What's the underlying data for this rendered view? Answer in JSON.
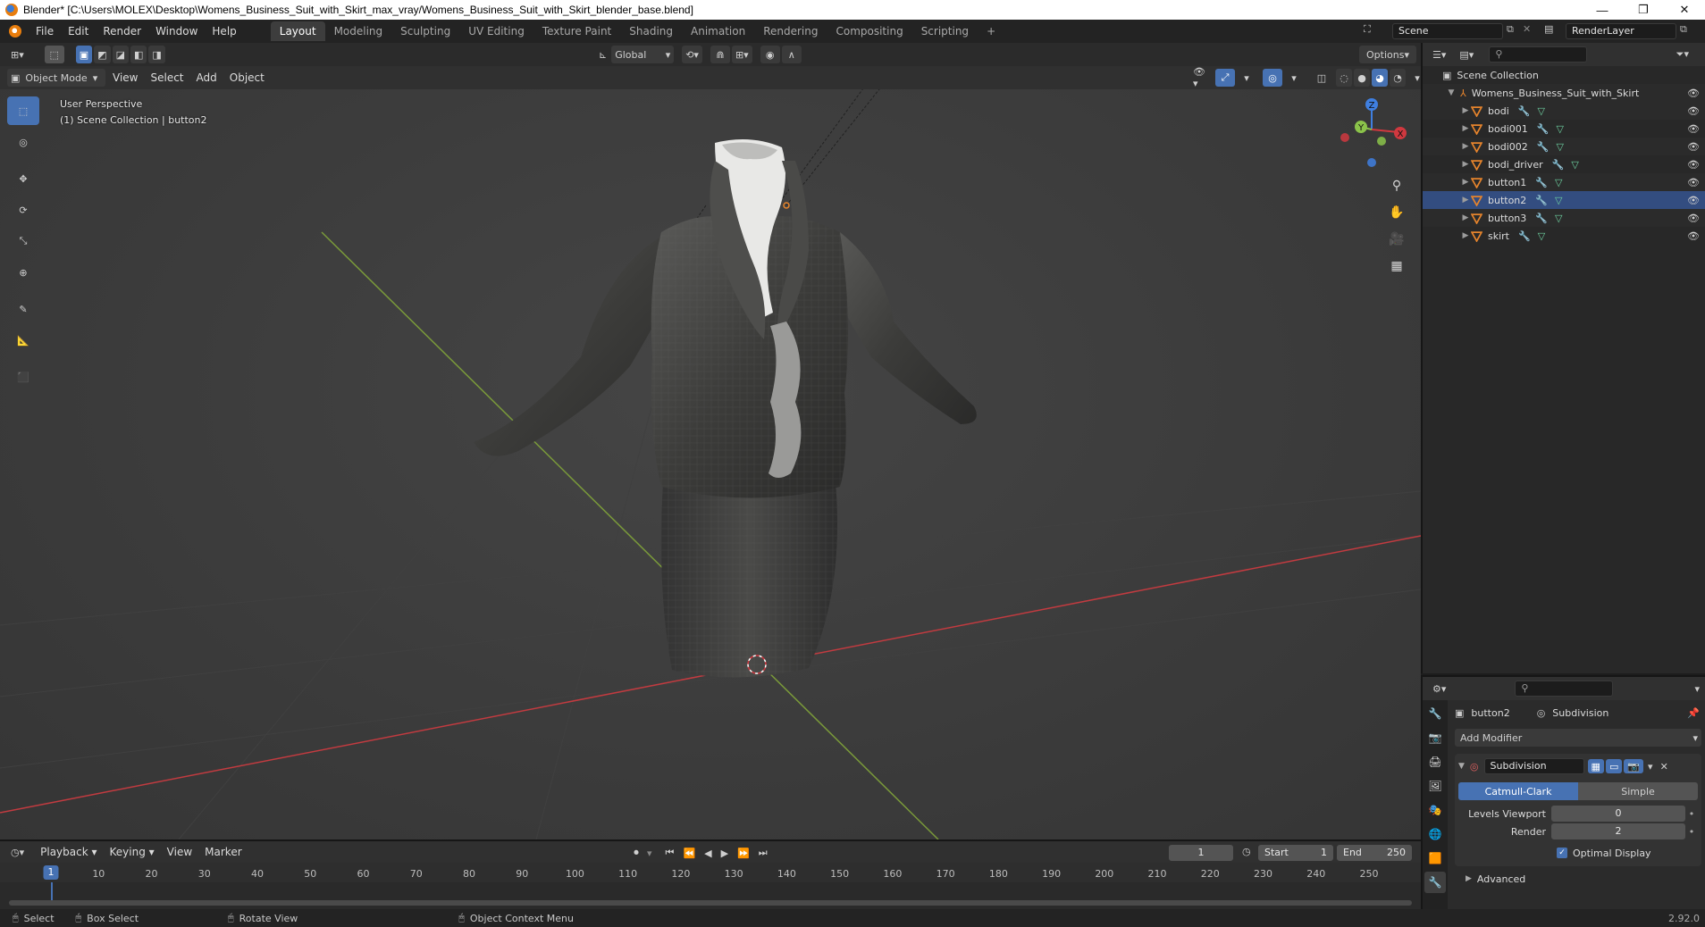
{
  "titlebar": {
    "title": "Blender* [C:\\Users\\MOLEX\\Desktop\\Womens_Business_Suit_with_Skirt_max_vray/Womens_Business_Suit_with_Skirt_blender_base.blend]",
    "minimize": "—",
    "restore": "❐",
    "close": "✕"
  },
  "menu": [
    "File",
    "Edit",
    "Render",
    "Window",
    "Help"
  ],
  "workspaces": [
    "Layout",
    "Modeling",
    "Sculpting",
    "UV Editing",
    "Texture Paint",
    "Shading",
    "Animation",
    "Rendering",
    "Compositing",
    "Scripting"
  ],
  "workspace_active": "Layout",
  "workspace_add": "+",
  "scene": {
    "name": "Scene",
    "render_layer": "RenderLayer"
  },
  "tool_header": {
    "orientation": "Global",
    "options": "Options"
  },
  "viewport_header": {
    "mode": "Object Mode",
    "menus": [
      "View",
      "Select",
      "Add",
      "Object"
    ]
  },
  "viewport": {
    "perspective_label": "User Perspective",
    "collection_label": "(1) Scene Collection | button2",
    "gizmo": {
      "x": "X",
      "y": "Y",
      "z": "Z"
    }
  },
  "outliner": {
    "root": "Scene Collection",
    "collection": "Womens_Business_Suit_with_Skirt",
    "objects": [
      "bodi",
      "bodi001",
      "bodi002",
      "bodi_driver",
      "button1",
      "button2",
      "button3",
      "skirt"
    ],
    "selected": "button2"
  },
  "properties": {
    "object": "button2",
    "modifier_tab": "Subdivision",
    "add_modifier": "Add Modifier",
    "modifier_name": "Subdivision",
    "mode_catmull": "Catmull-Clark",
    "mode_simple": "Simple",
    "levels_viewport_label": "Levels Viewport",
    "levels_viewport_value": "0",
    "render_label": "Render",
    "render_value": "2",
    "optimal_display": "Optimal Display",
    "advanced": "Advanced"
  },
  "timeline": {
    "menus": [
      "Playback",
      "Keying",
      "View",
      "Marker"
    ],
    "current_frame": "1",
    "start_label": "Start",
    "start_value": "1",
    "end_label": "End",
    "end_value": "250",
    "ticks": [
      "1",
      "10",
      "20",
      "30",
      "40",
      "50",
      "60",
      "70",
      "80",
      "90",
      "100",
      "110",
      "120",
      "130",
      "140",
      "150",
      "160",
      "170",
      "180",
      "190",
      "200",
      "210",
      "220",
      "230",
      "240",
      "250"
    ]
  },
  "statusbar": {
    "select": "Select",
    "box_select": "Box Select",
    "rotate_view": "Rotate View",
    "context_menu": "Object Context Menu",
    "version": "2.92.0"
  },
  "colors": {
    "accent": "#4772b3",
    "selection": "#334d80",
    "x_axis": "#d0383f",
    "y_axis": "#8bc34a",
    "z_axis": "#3f7fe0",
    "mesh": "#e6842c"
  }
}
